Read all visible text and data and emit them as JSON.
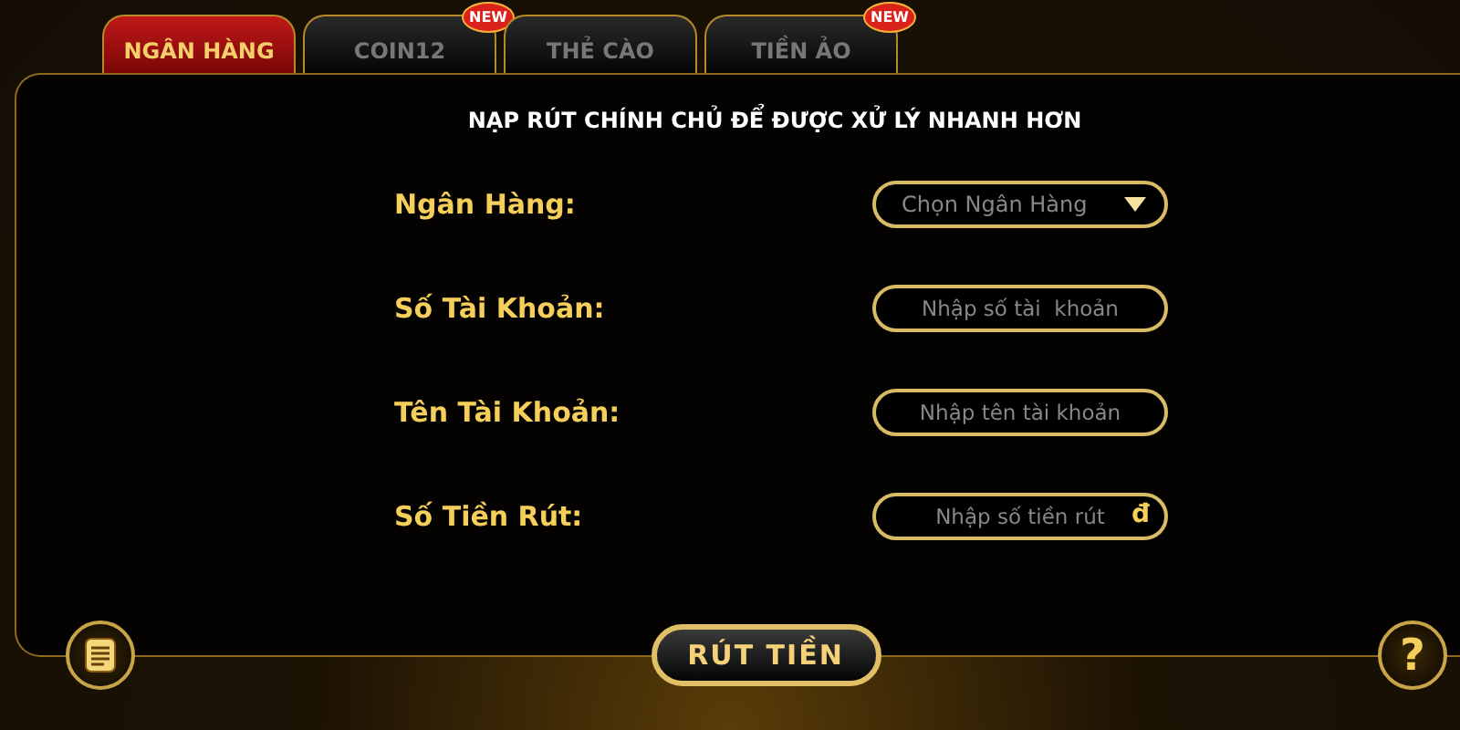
{
  "tabs": [
    {
      "label": "NGÂN HÀNG",
      "selected": true
    },
    {
      "label": "COIN12",
      "selected": false,
      "badge": "NEW"
    },
    {
      "label": "THẺ CÀO",
      "selected": false
    },
    {
      "label": "TIỀN ẢO",
      "selected": false,
      "badge": "NEW"
    }
  ],
  "notice": "NẠP RÚT CHÍNH CHỦ ĐỂ ĐƯỢC XỬ LÝ NHANH HƠN",
  "fields": [
    {
      "label": "Ngân Hàng:",
      "kind": "dropdown",
      "placeholder": "Chọn Ngân Hàng"
    },
    {
      "label": "Số Tài Khoản:",
      "kind": "input",
      "placeholder": "Nhập số tài  khoản"
    },
    {
      "label": "Tên Tài Khoản:",
      "kind": "input",
      "placeholder": "Nhập tên tài khoản"
    },
    {
      "label": "Số Tiền Rút:",
      "kind": "input",
      "placeholder": "Nhập số tiền rút",
      "suffix": "đ"
    }
  ],
  "submit": "RÚT TIỀN",
  "help": "?"
}
